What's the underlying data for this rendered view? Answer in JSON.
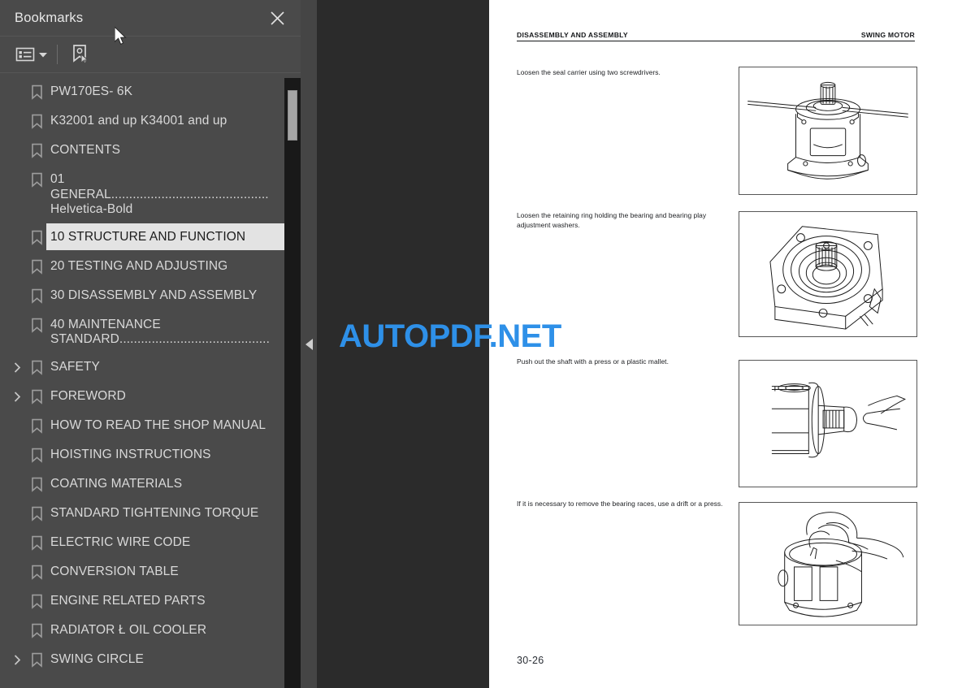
{
  "sidebar": {
    "title": "Bookmarks",
    "close_icon": "close-icon",
    "toolbar": {
      "list_options_icon": "list-options-icon",
      "caret_icon": "chevron-down-icon",
      "new_bookmark_icon": "new-bookmark-icon"
    },
    "items": [
      {
        "label": "PW170ES- 6K",
        "expandable": false,
        "selected": false
      },
      {
        "label": "K32001 and up K34001 and up",
        "expandable": false,
        "selected": false
      },
      {
        "label": "CONTENTS",
        "expandable": false,
        "selected": false
      },
      {
        "label": "01\nGENERAL............................................\nHelvetica-Bold",
        "expandable": false,
        "selected": false
      },
      {
        "label": "10 STRUCTURE AND FUNCTION",
        "expandable": false,
        "selected": true
      },
      {
        "label": "20 TESTING AND ADJUSTING",
        "expandable": false,
        "selected": false
      },
      {
        "label": "30 DISASSEMBLY AND ASSEMBLY",
        "expandable": false,
        "selected": false
      },
      {
        "label": "40 MAINTENANCE\nSTANDARD..........................................",
        "expandable": false,
        "selected": false
      },
      {
        "label": "SAFETY",
        "expandable": true,
        "selected": false
      },
      {
        "label": "FOREWORD",
        "expandable": true,
        "selected": false
      },
      {
        "label": "HOW TO READ THE SHOP MANUAL",
        "expandable": false,
        "selected": false
      },
      {
        "label": "HOISTING INSTRUCTIONS",
        "expandable": false,
        "selected": false
      },
      {
        "label": "COATING MATERIALS",
        "expandable": false,
        "selected": false
      },
      {
        "label": "STANDARD TIGHTENING TORQUE",
        "expandable": false,
        "selected": false
      },
      {
        "label": "ELECTRIC WIRE CODE",
        "expandable": false,
        "selected": false
      },
      {
        "label": "CONVERSION TABLE",
        "expandable": false,
        "selected": false
      },
      {
        "label": "ENGINE RELATED PARTS",
        "expandable": false,
        "selected": false
      },
      {
        "label": "RADIATOR Ł OIL COOLER",
        "expandable": false,
        "selected": false
      },
      {
        "label": "SWING CIRCLE",
        "expandable": true,
        "selected": false
      }
    ],
    "scrollbar": {
      "name": "bookmarks-scrollbar"
    }
  },
  "gutter": {
    "collapse_icon": "collapse-left-icon"
  },
  "document": {
    "header_left": "DISASSEMBLY AND ASSEMBLY",
    "header_right": "SWING MOTOR",
    "page_number": "30-26",
    "steps": [
      {
        "text": "Loosen the seal carrier using two screwdrivers.",
        "figure": "swing-motor-seal-carrier-figure"
      },
      {
        "text": "Loosen the retaining ring holding the bearing and bearing play adjustment washers.",
        "figure": "swing-motor-retaining-ring-figure"
      },
      {
        "text": "Push out the shaft with a press or a plastic mallet.",
        "figure": "swing-motor-shaft-removal-figure"
      },
      {
        "text": "If it is necessary to remove the bearing races, use a drift or a press.",
        "figure": "swing-motor-bearing-race-figure"
      }
    ]
  },
  "watermark": {
    "text": "AUTOPDF.NET",
    "color": "#2e90e8"
  },
  "colors": {
    "sidebar_bg": "#4a4a4a",
    "gutter_bg": "#2b2b2b",
    "page_bg": "#ffffff",
    "selected_bg": "#e3e3e3",
    "accent": "#2e90e8"
  }
}
